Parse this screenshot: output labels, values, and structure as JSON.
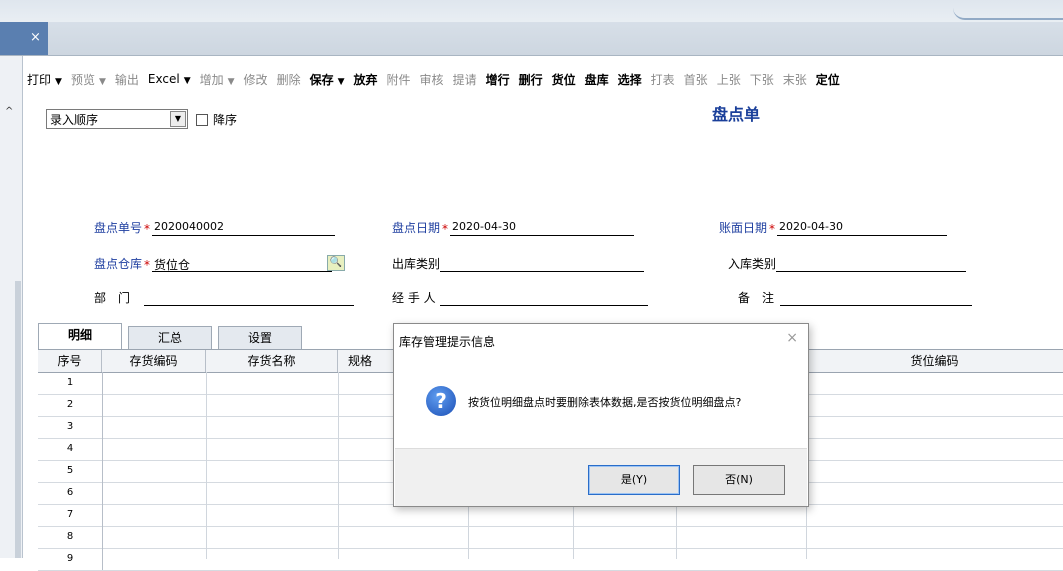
{
  "window": {
    "tab_close": "×"
  },
  "toolbar": {
    "items": [
      {
        "label": "打印",
        "dropdown": true,
        "dim": false,
        "bold": false
      },
      {
        "label": "预览",
        "dropdown": true,
        "dim": true,
        "bold": false
      },
      {
        "label": "输出",
        "dropdown": false,
        "dim": true,
        "bold": false
      },
      {
        "label": "Excel",
        "dropdown": true,
        "dim": false,
        "bold": false
      },
      {
        "label": "增加",
        "dropdown": true,
        "dim": true,
        "bold": false
      },
      {
        "label": "修改",
        "dropdown": false,
        "dim": true,
        "bold": false
      },
      {
        "label": "删除",
        "dropdown": false,
        "dim": true,
        "bold": false
      },
      {
        "label": "保存",
        "dropdown": true,
        "dim": false,
        "bold": true
      },
      {
        "label": "放弃",
        "dropdown": false,
        "dim": false,
        "bold": true
      },
      {
        "label": "附件",
        "dropdown": false,
        "dim": true,
        "bold": false
      },
      {
        "label": "审核",
        "dropdown": false,
        "dim": true,
        "bold": false
      },
      {
        "label": "提请",
        "dropdown": false,
        "dim": true,
        "bold": false
      },
      {
        "label": "增行",
        "dropdown": false,
        "dim": false,
        "bold": true
      },
      {
        "label": "删行",
        "dropdown": false,
        "dim": false,
        "bold": true
      },
      {
        "label": "货位",
        "dropdown": false,
        "dim": false,
        "bold": true
      },
      {
        "label": "盘库",
        "dropdown": false,
        "dim": false,
        "bold": true
      },
      {
        "label": "选择",
        "dropdown": false,
        "dim": false,
        "bold": true
      },
      {
        "label": "打表",
        "dropdown": false,
        "dim": true,
        "bold": false
      },
      {
        "label": "首张",
        "dropdown": false,
        "dim": true,
        "bold": false
      },
      {
        "label": "上张",
        "dropdown": false,
        "dim": true,
        "bold": false
      },
      {
        "label": "下张",
        "dropdown": false,
        "dim": true,
        "bold": false
      },
      {
        "label": "末张",
        "dropdown": false,
        "dim": true,
        "bold": false
      },
      {
        "label": "定位",
        "dropdown": false,
        "dim": false,
        "bold": true
      }
    ],
    "dropdown_glyph": "▼"
  },
  "sort": {
    "value": "录入顺序",
    "arrow": "▼",
    "desc_label": "降序"
  },
  "form": {
    "title": "盘点单",
    "required_mark": "*",
    "doc_no": {
      "label": "盘点单号",
      "value": "2020040002"
    },
    "count_date": {
      "label": "盘点日期",
      "value": "2020-04-30"
    },
    "book_date": {
      "label": "账面日期",
      "value": "2020-04-30"
    },
    "warehouse": {
      "label": "盘点仓库",
      "value": "货位仓"
    },
    "out_type": {
      "label": "出库类别",
      "value": ""
    },
    "in_type": {
      "label": "入库类别",
      "value": ""
    },
    "dept": {
      "label": "部　门",
      "value": ""
    },
    "handler": {
      "label": "经 手 人",
      "value": ""
    },
    "remark": {
      "label": "备　注",
      "value": ""
    }
  },
  "tabs": [
    "明细",
    "汇总",
    "设置"
  ],
  "grid": {
    "columns": [
      "序号",
      "存货编码",
      "存货名称",
      "规格",
      "货位编码"
    ],
    "rows": [
      "1",
      "2",
      "3",
      "4",
      "5",
      "6",
      "7",
      "8",
      "9"
    ]
  },
  "dialog": {
    "title": "库存管理提示信息",
    "close": "×",
    "icon": "?",
    "message": "按货位明细盘点时要删除表体数据,是否按货位明细盘点?",
    "yes": "是(Y)",
    "no": "否(N)"
  }
}
